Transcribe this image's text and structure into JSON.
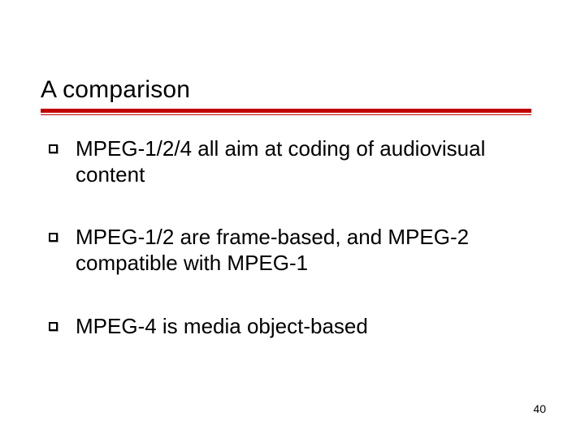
{
  "slide": {
    "title": "A comparison",
    "page_number": "40",
    "accent_color": "#c00000",
    "bullets": [
      {
        "text": "MPEG-1/2/4 all aim at coding of audiovisual content"
      },
      {
        "text": "MPEG-1/2 are frame-based, and MPEG-2 compatible with MPEG-1"
      },
      {
        "text": "MPEG-4 is media object-based"
      }
    ]
  }
}
